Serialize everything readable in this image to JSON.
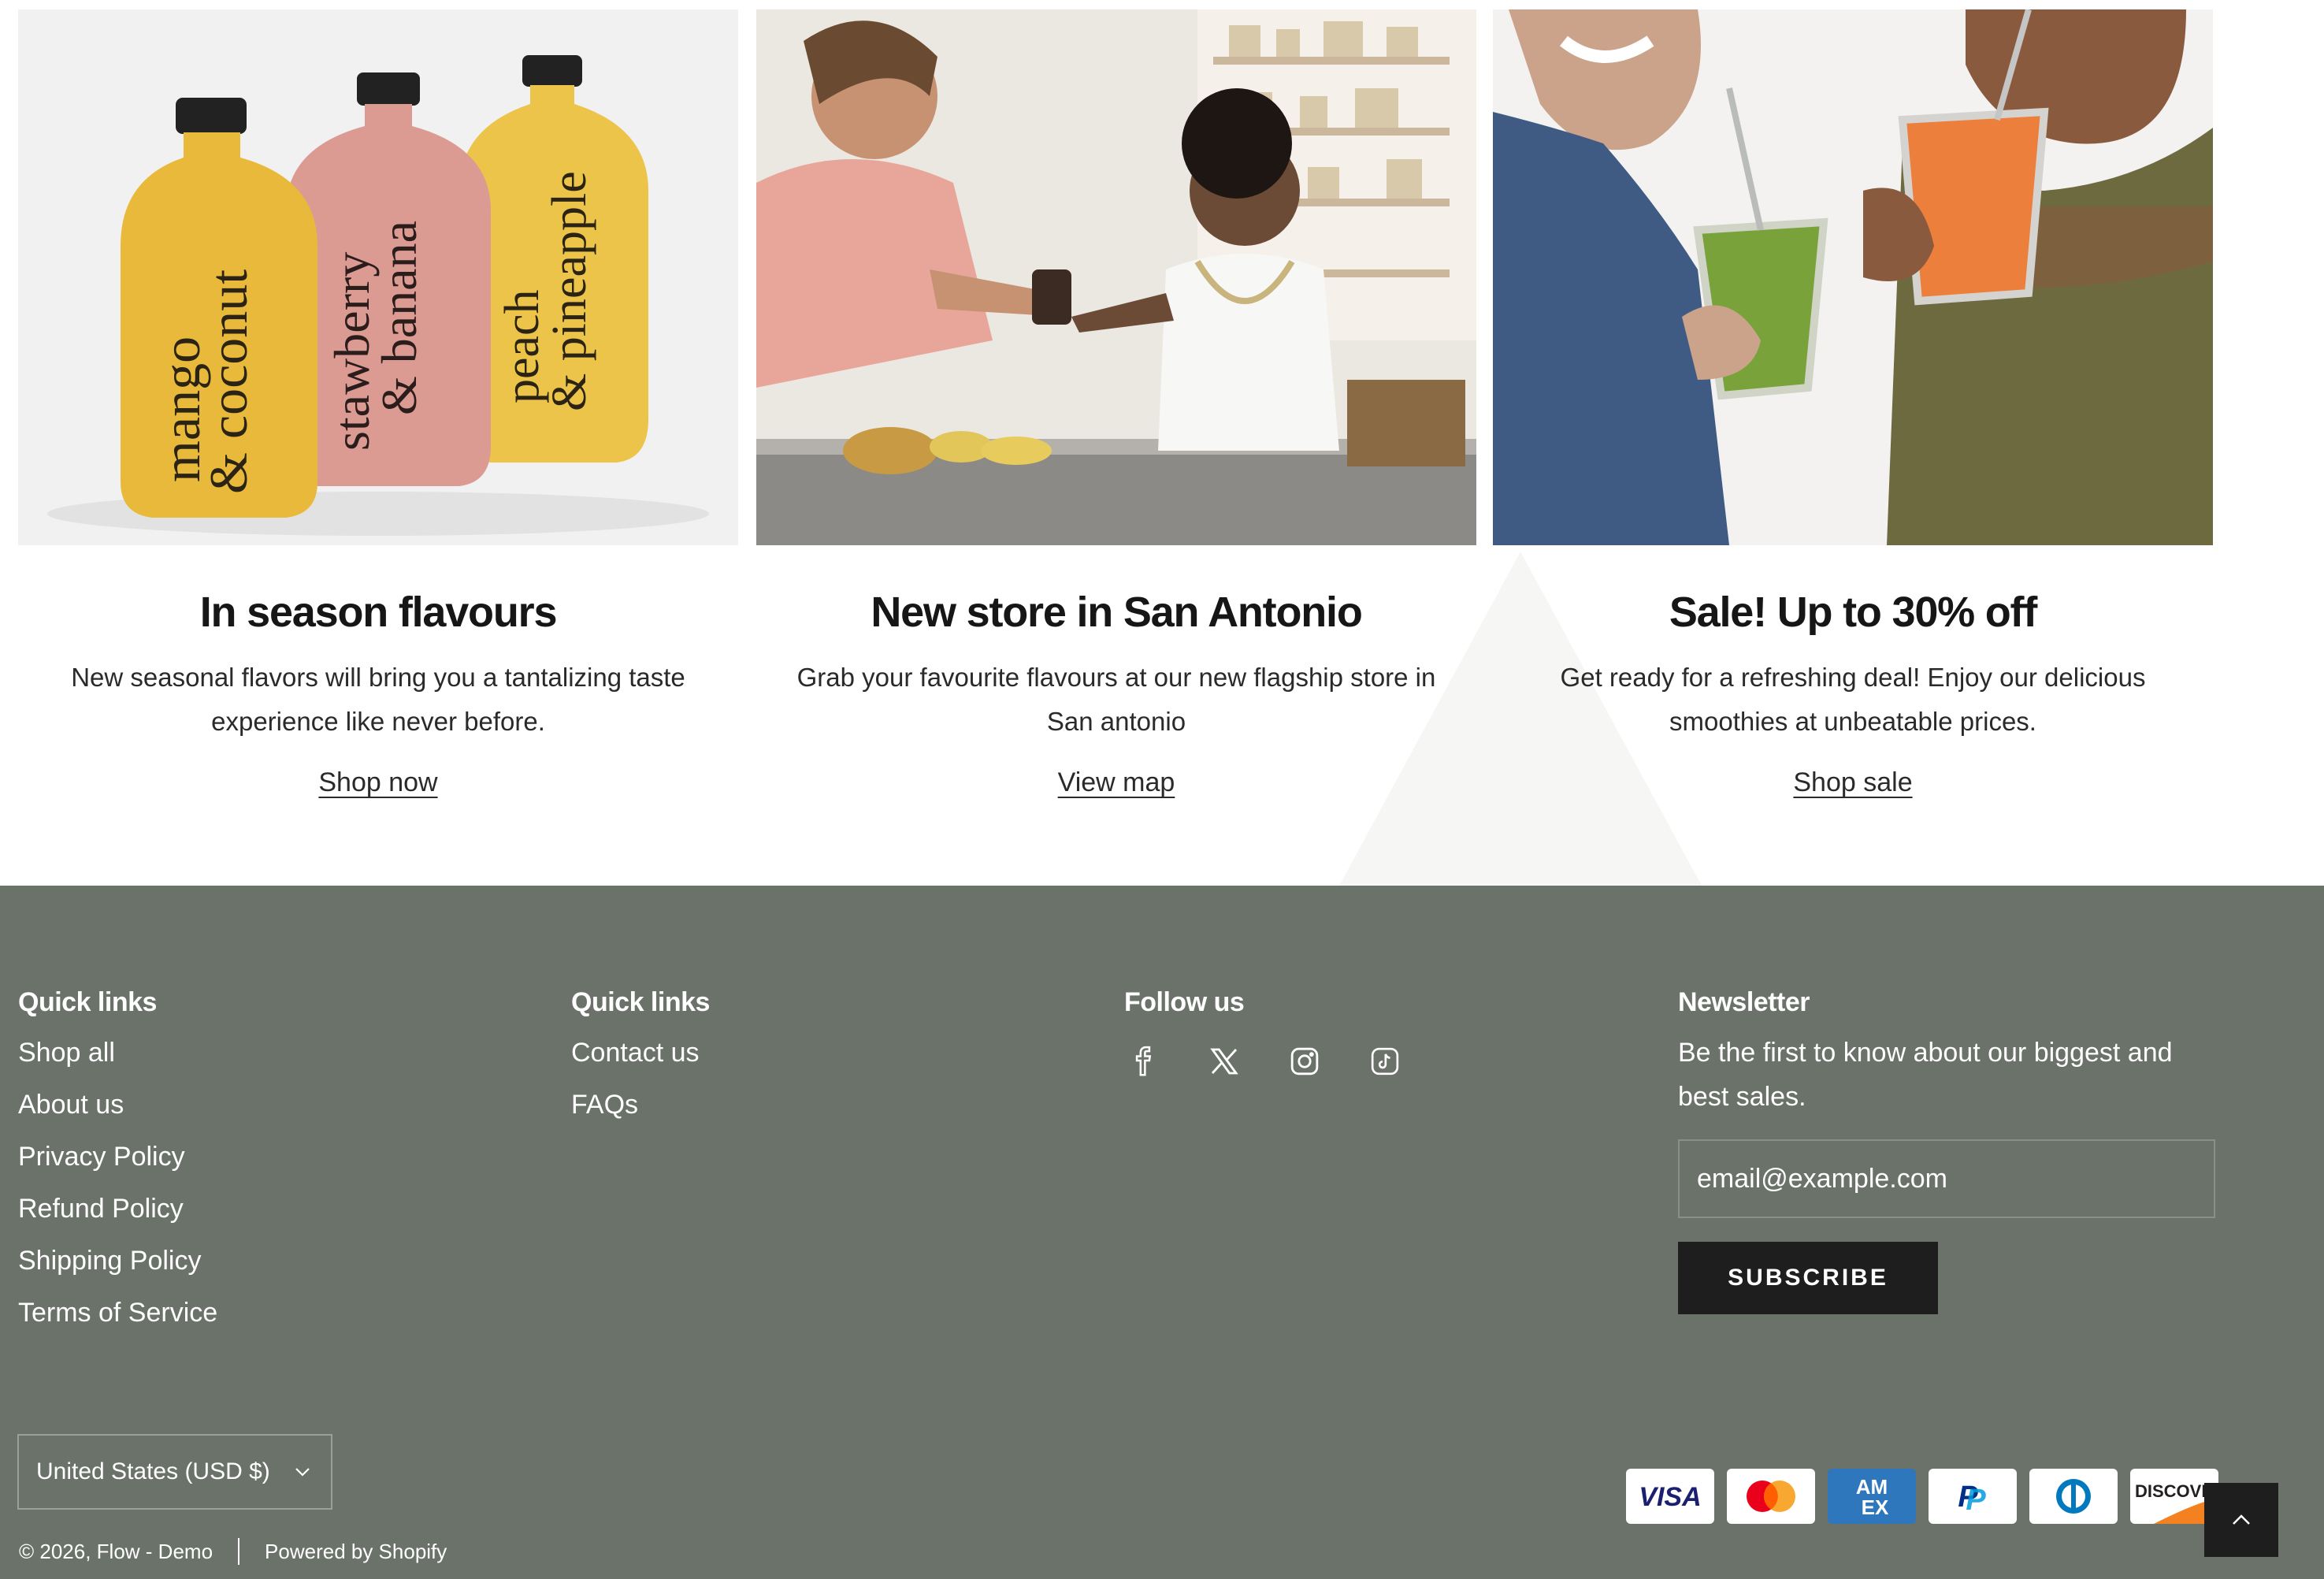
{
  "cards": [
    {
      "title": "In season flavours",
      "text": "New seasonal flavors will bring you a tantalizing taste experience like never before.",
      "link": "Shop now",
      "bottles": [
        {
          "line1": "mango",
          "line2": "& coconut",
          "color": "#e8b93a"
        },
        {
          "line1": "stawberry",
          "line2": "& banana",
          "color": "#dc9b92"
        },
        {
          "line1": "peach",
          "line2": "& pineapple",
          "color": "#ecc44a"
        }
      ]
    },
    {
      "title": "New store in San Antonio",
      "text": "Grab your favourite flavours at our new flagship store in San antonio",
      "link": "View map"
    },
    {
      "title": "Sale! Up to 30% off",
      "text": "Get ready for a refreshing deal! Enjoy our delicious smoothies at unbeatable prices.",
      "link": "Shop sale"
    }
  ],
  "footer": {
    "col1": {
      "heading": "Quick links",
      "links": [
        "Shop all",
        "About us",
        "Privacy Policy",
        "Refund Policy",
        "Shipping Policy",
        "Terms of Service"
      ]
    },
    "col2": {
      "heading": "Quick links",
      "links": [
        "Contact us",
        "FAQs"
      ]
    },
    "follow": {
      "heading": "Follow us",
      "icons": [
        "facebook-icon",
        "x-icon",
        "instagram-icon",
        "tiktok-icon"
      ]
    },
    "newsletter": {
      "heading": "Newsletter",
      "text": "Be the first to know about our biggest and best sales.",
      "placeholder": "email@example.com",
      "button": "SUBSCRIBE"
    },
    "currency": "United States (USD $)",
    "copyright": "© 2026, Flow - Demo",
    "powered": "Powered by Shopify",
    "payments": [
      "VISA",
      "Mastercard",
      "AMEX",
      "PayPal",
      "Diners Club",
      "DISCOVER"
    ],
    "colors": {
      "background": "#6b726a",
      "button": "#1e1e1e"
    }
  }
}
